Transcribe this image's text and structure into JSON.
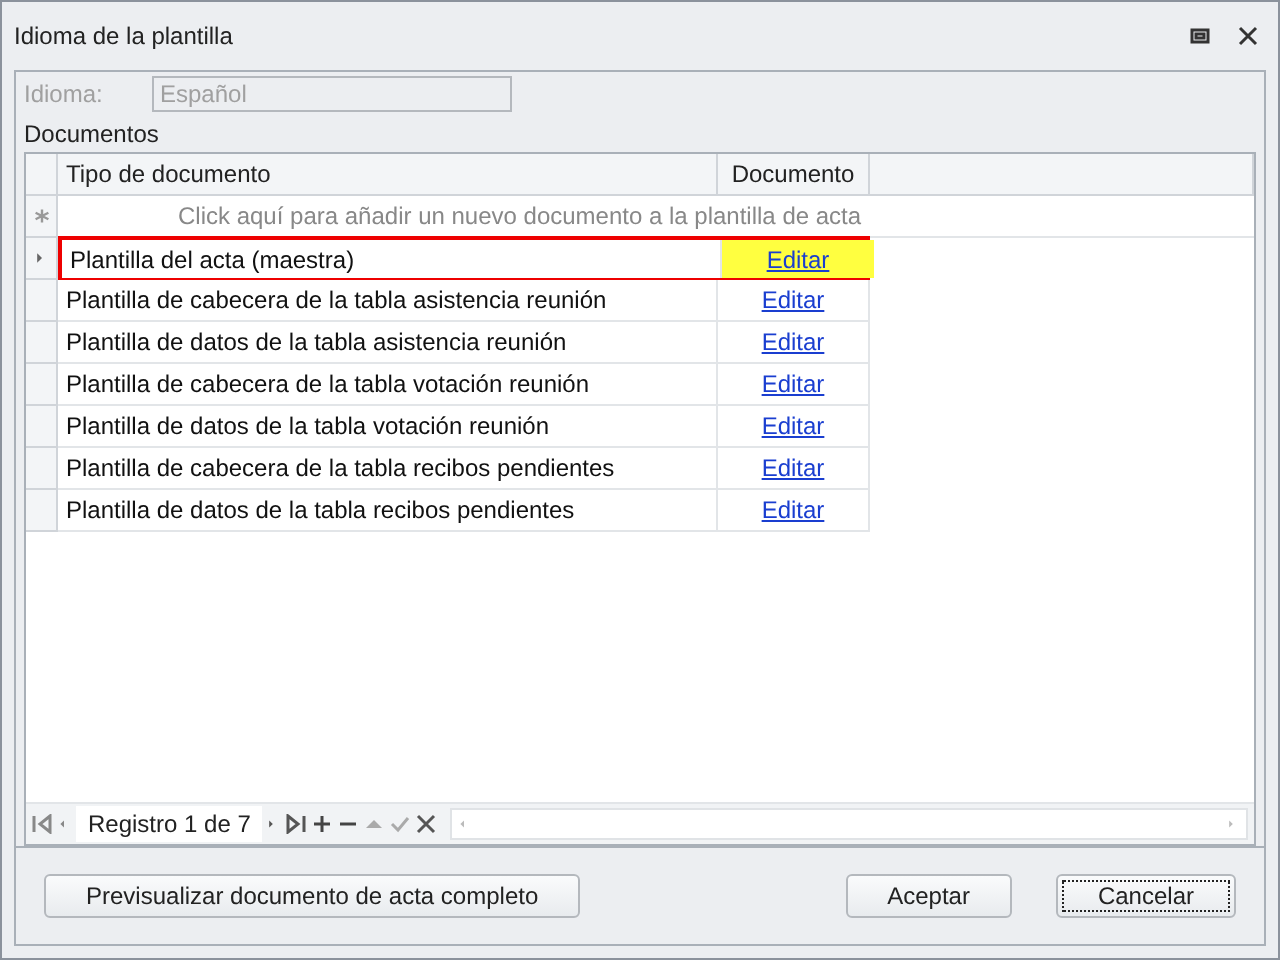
{
  "window": {
    "title": "Idioma de la plantilla"
  },
  "idioma": {
    "label": "Idioma:",
    "value": "Español",
    "disabled": true
  },
  "documentos": {
    "label": "Documentos",
    "columns": [
      "Tipo de documento",
      "Documento"
    ],
    "new_row_prompt": "Click aquí para añadir un nuevo documento a la plantilla de acta",
    "rows": [
      {
        "tipo": "Plantilla del acta (maestra)",
        "documento": "Editar",
        "selected": true
      },
      {
        "tipo": "Plantilla de cabecera de la tabla asistencia reunión",
        "documento": "Editar",
        "selected": false
      },
      {
        "tipo": "Plantilla de datos de la tabla asistencia reunión",
        "documento": "Editar",
        "selected": false
      },
      {
        "tipo": "Plantilla de cabecera de la tabla votación reunión",
        "documento": "Editar",
        "selected": false
      },
      {
        "tipo": "Plantilla de datos de la tabla votación reunión",
        "documento": "Editar",
        "selected": false
      },
      {
        "tipo": "Plantilla de cabecera de la tabla recibos pendientes",
        "documento": "Editar",
        "selected": false
      },
      {
        "tipo": "Plantilla de datos de la tabla recibos pendientes",
        "documento": "Editar",
        "selected": false
      }
    ],
    "navigator": "Registro 1 de 7"
  },
  "buttons": [
    {
      "label": "Previsualizar documento de acta completo",
      "focused": false
    },
    {
      "label": "Aceptar",
      "focused": false
    },
    {
      "label": "Cancelar",
      "focused": true
    }
  ]
}
